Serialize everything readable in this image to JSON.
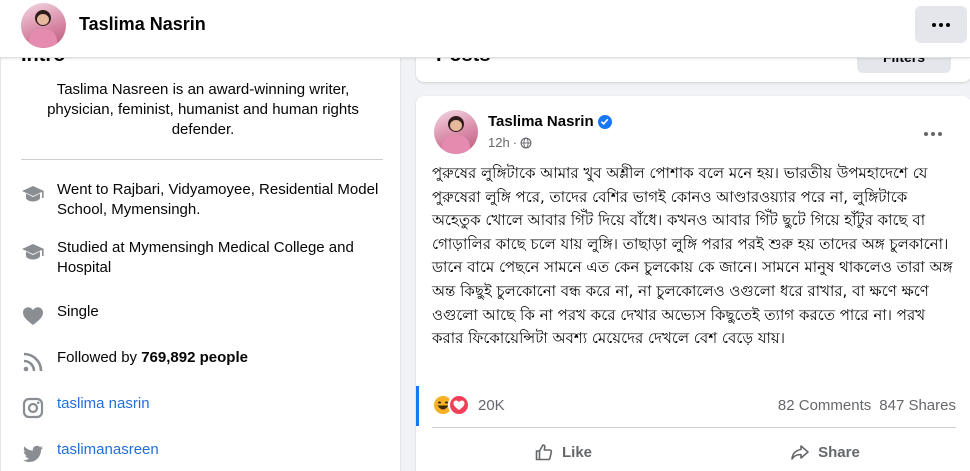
{
  "header": {
    "page_name": "Taslima Nasrin",
    "more_icon": "ellipsis-icon"
  },
  "intro": {
    "heading": "Intro",
    "bio": "Taslima Nasreen is an award-winning writer, physician, feminist, humanist and human rights defender.",
    "items": [
      {
        "icon": "graduation-cap-icon",
        "text": "Went to Rajbari, Vidyamoyee, Residential Model School, Mymensingh."
      },
      {
        "icon": "graduation-cap-icon",
        "text": "Studied at Mymensingh Medical College and Hospital"
      },
      {
        "icon": "heart-icon",
        "text": "Single"
      },
      {
        "icon": "rss-icon",
        "followed_prefix": "Followed by ",
        "followed_count": "769,892 people"
      },
      {
        "icon": "instagram-icon",
        "text": "taslima nasrin"
      },
      {
        "icon": "twitter-icon",
        "text": "taslimanasreen"
      }
    ]
  },
  "posts_section": {
    "heading": "Posts",
    "filter_label": "Filters"
  },
  "post": {
    "author": "Taslima Nasrin",
    "verified_icon": "verified-check-icon",
    "time": "12h",
    "audience_icon": "globe-icon",
    "text": "পুরুষের লুঙ্গিটাকে আমার খুব অশ্লীল পোশাক বলে মনে হয়। ভারতীয় উপমহাদেশে যে পুরুষেরা লুঙ্গি পরে, তাদের বেশির ভাগই  কোনও আণ্ডারওয়্যার পরে না, লুঙ্গিটাকে অহেতুক খোলে আবার গিঁট দিয়ে বাঁধে। কখনও আবার  গিঁট ছুটে গিয়ে হাঁটুর কাছে বা গোড়ালির কাছে চলে যায় লুঙ্গি। তাছাড়া লুঙ্গি পরার পরই শুরু হয় তাদের অঙ্গ চুলকানো। ডানে বামে পেছনে সামনে এত কেন চুলকোয় কে জানে। সামনে মানুষ থাকলেও তারা অঙ্গ অন্ত কিছুই চুলকোনো বন্ধ করে না, না চুলকোলেও ওগুলো ধরে রাখার, বা ক্ষণে ক্ষণে ওগুলো আছে কি না পরখ করে দেখার অভ্যেস কিছুতেই ত্যাগ করতে পারে না। পরখ করার ফিকোয়েন্সিটা অবশ্য মেয়েদের দেখলে বেশ বেড়ে যায়।",
    "reaction_icons": [
      "haha-emoji-icon",
      "love-emoji-icon"
    ],
    "reaction_count": "20K",
    "comments": "82 Comments",
    "shares": "847 Shares",
    "like_label": "Like",
    "share_label": "Share",
    "colors": {
      "accent": "#1877f2",
      "link": "#216fdb",
      "muted": "#65676b"
    }
  }
}
